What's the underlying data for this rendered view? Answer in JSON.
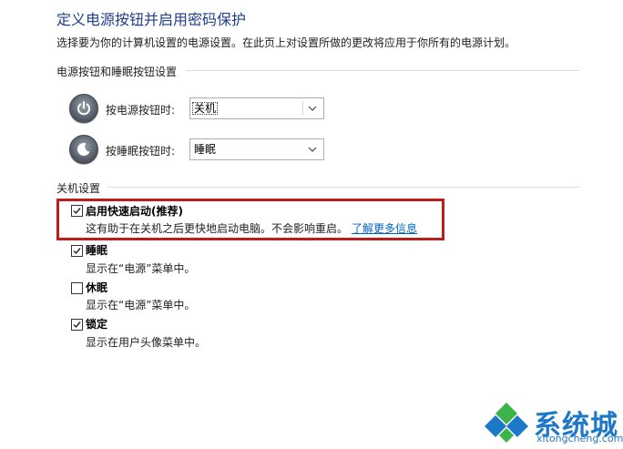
{
  "header": {
    "title": "定义电源按钮并启用密码保护",
    "description": "选择要为你的计算机设置的电源设置。在此页上对设置所做的更改将应用于你所有的电源计划。"
  },
  "power_section": {
    "title": "电源按钮和睡眠按钮设置",
    "power_button": {
      "label": "按电源按钮时:",
      "value": "关机",
      "icon": "power-icon"
    },
    "sleep_button": {
      "label": "按睡眠按钮时:",
      "value": "睡眠",
      "icon": "sleep-icon"
    }
  },
  "shutdown_section": {
    "title": "关机设置",
    "options": [
      {
        "label": "启用快速启动(推荐)",
        "desc": "这有助于在关机之后更快地启动电脑。不会影响重启。",
        "link": "了解更多信息",
        "checked": true
      },
      {
        "label": "睡眠",
        "desc": "显示在“电源”菜单中。",
        "checked": true
      },
      {
        "label": "休眠",
        "desc": "显示在“电源”菜单中。",
        "checked": false
      },
      {
        "label": "锁定",
        "desc": "显示在用户头像菜单中。",
        "checked": true
      }
    ]
  },
  "watermark": {
    "cn": "系统城",
    "en": "xitongcheng.com",
    "colors": {
      "blue": "#1e78c8",
      "green": "#3cb44a"
    }
  },
  "colors": {
    "title": "#1f3f8a",
    "highlight": "#b81e1e",
    "link": "#0066cc"
  }
}
